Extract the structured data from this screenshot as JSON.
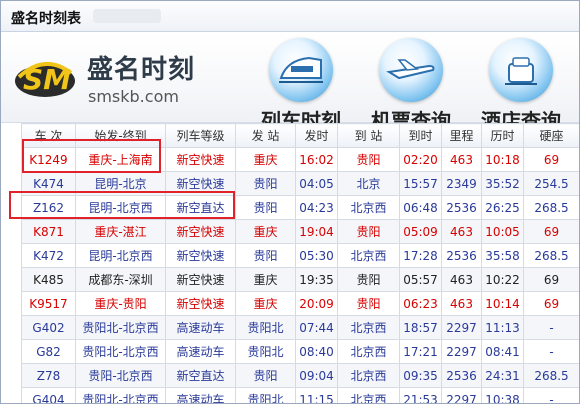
{
  "window": {
    "title": "盛名时刻表"
  },
  "header": {
    "brand": "盛名时刻",
    "domain": "smskb.com",
    "logo_letters": "SM",
    "nav": [
      {
        "label": "列车时刻",
        "icon": "train-icon"
      },
      {
        "label": "机票查询",
        "icon": "airplane-icon"
      },
      {
        "label": "酒店查询",
        "icon": "hotel-icon"
      }
    ]
  },
  "table": {
    "columns": [
      "车 次",
      "始发-终到",
      "列车等级",
      "发 站",
      "发时",
      "到 站",
      "到时",
      "里程",
      "历时",
      "硬座"
    ],
    "rows": [
      {
        "style": "red",
        "cells": [
          "K1249",
          "重庆-上海南",
          "新空快速",
          "重庆",
          "16:02",
          "贵阳",
          "02:20",
          "463",
          "10:18",
          "69"
        ]
      },
      {
        "style": "blue",
        "cells": [
          "K474",
          "昆明-北京",
          "新空快速",
          "贵阳",
          "04:05",
          "北京",
          "15:57",
          "2349",
          "35:52",
          "254.5"
        ]
      },
      {
        "style": "blue",
        "cells": [
          "Z162",
          "昆明-北京西",
          "新空直达",
          "贵阳",
          "04:23",
          "北京西",
          "06:48",
          "2536",
          "26:25",
          "268.5"
        ]
      },
      {
        "style": "red",
        "cells": [
          "K871",
          "重庆-湛江",
          "新空快速",
          "重庆",
          "19:04",
          "贵阳",
          "05:09",
          "463",
          "10:05",
          "69"
        ]
      },
      {
        "style": "blue",
        "cells": [
          "K472",
          "昆明-北京西",
          "新空快速",
          "贵阳",
          "05:30",
          "北京西",
          "17:28",
          "2536",
          "35:58",
          "268.5"
        ]
      },
      {
        "style": "dark",
        "cells": [
          "K485",
          "成都东-深圳",
          "新空快速",
          "重庆",
          "19:35",
          "贵阳",
          "05:57",
          "463",
          "10:22",
          "69"
        ]
      },
      {
        "style": "red",
        "cells": [
          "K9517",
          "重庆-贵阳",
          "新空快速",
          "重庆",
          "20:09",
          "贵阳",
          "06:23",
          "463",
          "10:14",
          "69"
        ]
      },
      {
        "style": "blue",
        "cells": [
          "G402",
          "贵阳北-北京西",
          "高速动车",
          "贵阳北",
          "07:44",
          "北京西",
          "18:57",
          "2297",
          "11:13",
          "-"
        ]
      },
      {
        "style": "blue",
        "cells": [
          "G82",
          "贵阳北-北京西",
          "高速动车",
          "贵阳北",
          "08:40",
          "北京西",
          "17:21",
          "2297",
          "08:41",
          "-"
        ]
      },
      {
        "style": "blue",
        "cells": [
          "Z78",
          "贵阳-北京西",
          "新空直达",
          "贵阳",
          "09:04",
          "北京西",
          "09:35",
          "2536",
          "24:31",
          "268.5"
        ]
      },
      {
        "style": "blue",
        "cells": [
          "G404",
          "贵阳北-北京西",
          "高速动车",
          "贵阳北",
          "11:15",
          "北京西",
          "21:53",
          "2297",
          "10:38",
          "-"
        ]
      }
    ]
  },
  "colors": {
    "red_text": "#d80000",
    "blue_text": "#2a3a9a",
    "highlight_box": "#e0232b"
  }
}
